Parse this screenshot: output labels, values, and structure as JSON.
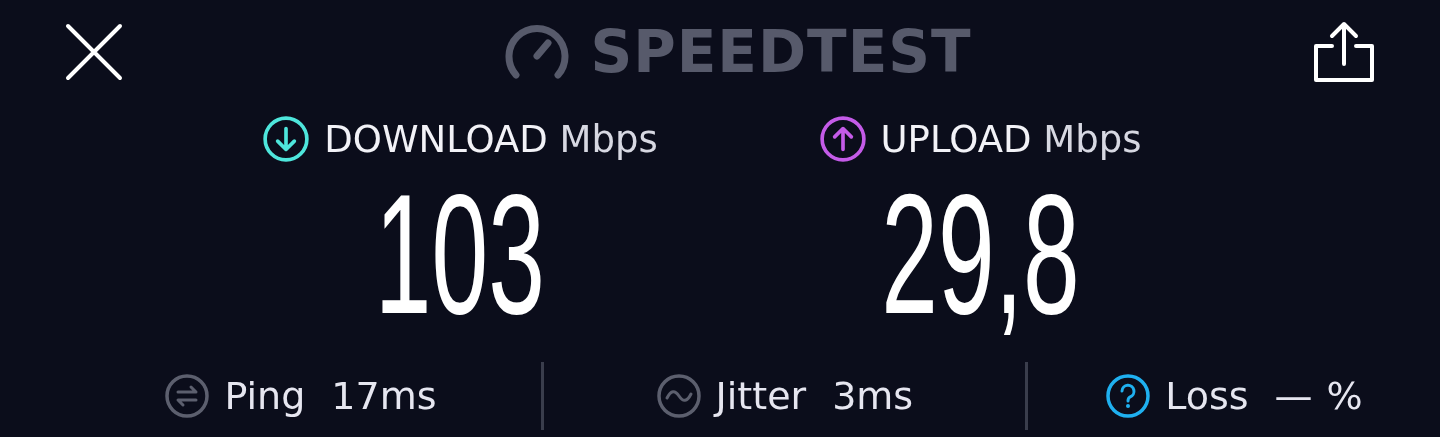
{
  "header": {
    "title": "SPEEDTEST"
  },
  "results": [
    {
      "kind": "download",
      "label": "DOWNLOAD",
      "unit": "Mbps",
      "value": "103",
      "color": "#4ee6dc"
    },
    {
      "kind": "upload",
      "label": "UPLOAD",
      "unit": "Mbps",
      "value": "29,8",
      "color": "#c45be8"
    }
  ],
  "metrics": [
    {
      "kind": "ping",
      "label": "Ping",
      "value": "17ms"
    },
    {
      "kind": "jitter",
      "label": "Jitter",
      "value": "3ms"
    },
    {
      "kind": "loss",
      "label": "Loss",
      "value": "—",
      "unit": "%"
    }
  ]
}
